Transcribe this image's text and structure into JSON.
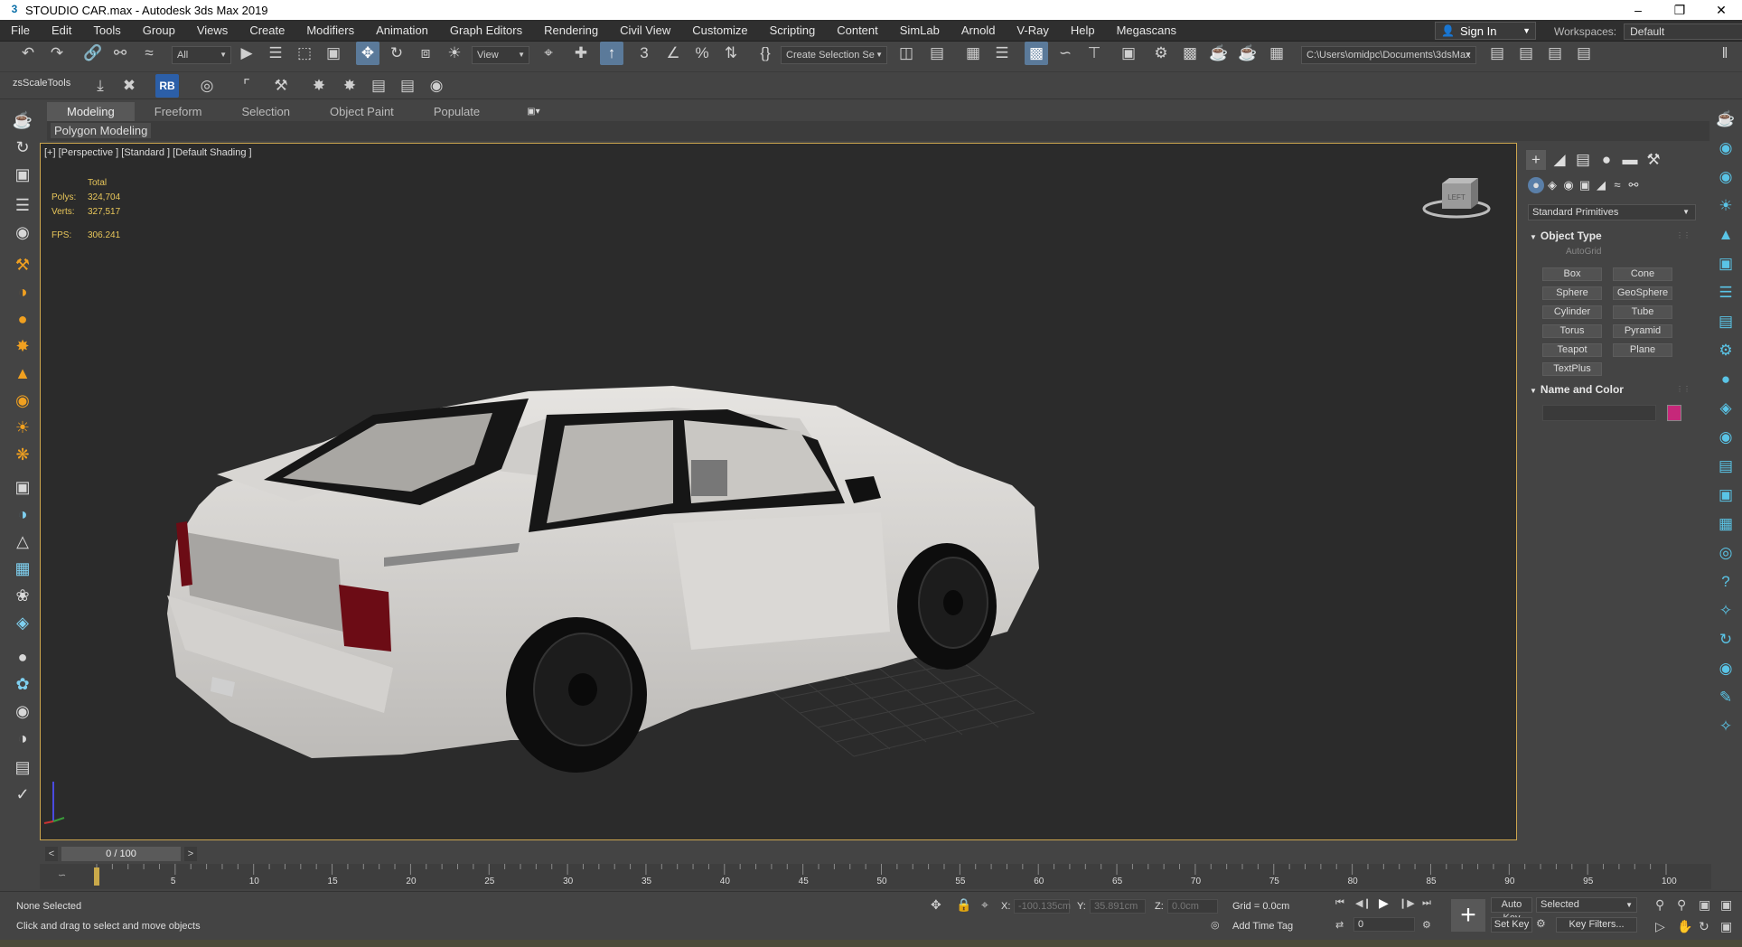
{
  "window": {
    "icon": "3",
    "title": "STOUDIO  CAR.max - Autodesk 3ds Max 2019",
    "controls": [
      "minimize-icon",
      "restore-icon",
      "close-icon"
    ]
  },
  "menu": [
    "File",
    "Edit",
    "Tools",
    "Group",
    "Views",
    "Create",
    "Modifiers",
    "Animation",
    "Graph Editors",
    "Rendering",
    "Civil View",
    "Customize",
    "Scripting",
    "Content",
    "SimLab",
    "Arnold",
    "V-Ray",
    "Help",
    "Megascans"
  ],
  "account": {
    "sign_in": "Sign In",
    "workspaces_label": "Workspaces:",
    "workspace_value": "Default"
  },
  "toolbar": {
    "selection_filter": "All",
    "ref_coord": "View",
    "selection_set": "Create Selection Se",
    "project_path": "C:\\Users\\omidpc\\Documents\\3dsMax"
  },
  "toolbar2": {
    "plugin_label": "zsScaleTools",
    "rb_badge": "RB"
  },
  "ribbon": {
    "tabs": [
      "Modeling",
      "Freeform",
      "Selection",
      "Object Paint",
      "Populate"
    ],
    "active_tab": "Modeling",
    "panel_label": "Polygon Modeling"
  },
  "viewport": {
    "label": "[+] [Perspective ] [Standard ] [Default Shading ]",
    "stats": {
      "total_label": "Total",
      "polys_label": "Polys:",
      "polys": "324,704",
      "verts_label": "Verts:",
      "verts": "327,517",
      "fps_label": "FPS:",
      "fps": "306.241"
    },
    "viewcube_label": "LEFT"
  },
  "command_panel": {
    "category": "Standard Primitives",
    "object_type_title": "Object Type",
    "autogrid": "AutoGrid",
    "primitives": [
      "Box",
      "Cone",
      "Sphere",
      "GeoSphere",
      "Cylinder",
      "Tube",
      "Torus",
      "Pyramid",
      "Teapot",
      "Plane",
      "TextPlus"
    ],
    "name_color_title": "Name and Color",
    "object_color": "#c6287a"
  },
  "timeline": {
    "prev": "<",
    "next": ">",
    "frame_display": "0 / 100",
    "ticks": [
      "5",
      "10",
      "15",
      "20",
      "25",
      "30",
      "35",
      "40",
      "45",
      "50",
      "55",
      "60",
      "65",
      "70",
      "75",
      "80",
      "85",
      "90",
      "95",
      "100"
    ]
  },
  "status": {
    "selection": "None Selected",
    "prompt": "Click and drag to select and move objects",
    "x_label": "X:",
    "x_value": "-100.135cm",
    "y_label": "Y:",
    "y_value": "35.891cm",
    "z_label": "Z:",
    "z_value": "0.0cm",
    "grid": "Grid = 0.0cm",
    "add_time_tag": "Add Time Tag",
    "auto_key": "Auto Key",
    "set_key": "Set Key",
    "key_mode": "Selected",
    "key_filters": "Key Filters...",
    "current_frame": "0"
  }
}
